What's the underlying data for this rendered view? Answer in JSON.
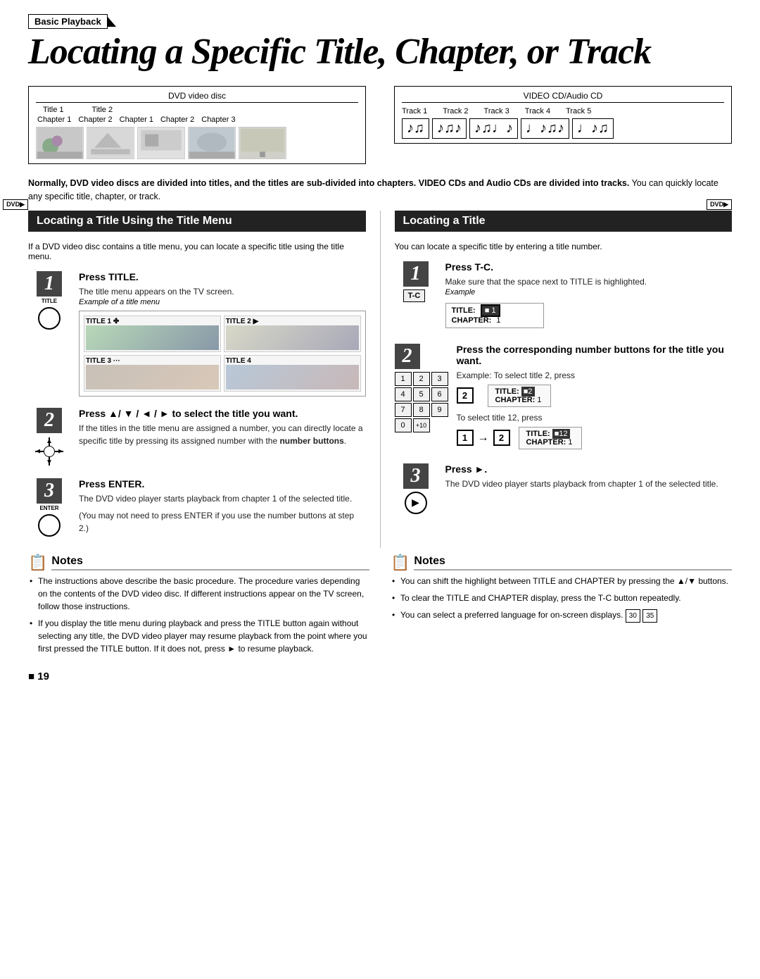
{
  "page": {
    "breadcrumb": "Basic Playback",
    "title": "Locating a Specific Title, Chapter, or Track",
    "page_number": "■ 19"
  },
  "dvd_diagram": {
    "label": "DVD video disc",
    "title1": "Title 1",
    "title2": "Title 2",
    "chapters": [
      "Chapter 1",
      "Chapter 2",
      "Chapter 1",
      "Chapter 2",
      "Chapter 3"
    ]
  },
  "cd_diagram": {
    "label": "VIDEO CD/Audio CD",
    "tracks": [
      "Track 1",
      "Track 2",
      "Track 3",
      "Track 4",
      "Track 5"
    ]
  },
  "intro_text": "Normally, DVD video discs are divided into titles, and the titles are sub-divided into chapters. VIDEO CDs and Audio CDs are divided into tracks. You can quickly locate any specific title, chapter, or track.",
  "left_section": {
    "header": "Locating a Title Using the Title Menu",
    "badge": "DVD",
    "intro": "If a DVD video disc contains a title menu, you can locate a specific title using the title menu.",
    "step1": {
      "number": "1",
      "icon_label": "TITLE",
      "title": "Press TITLE.",
      "desc1": "The title menu appears on the TV screen.",
      "example_label": "Example of a title menu",
      "titles": [
        "TITLE 1",
        "TITLE 2",
        "TITLE 3",
        "TITLE 4"
      ]
    },
    "step2": {
      "number": "2",
      "title": "Press ▲/ ▼ / ◄ / ► to select the title you want.",
      "desc1": "If the titles in the title menu are assigned a number, you can directly locate a specific title by pressing its assigned number with the",
      "desc_bold": "number buttons",
      "desc2": "."
    },
    "step3": {
      "number": "3",
      "icon_label": "ENTER",
      "title": "Press ENTER.",
      "desc1": "The DVD video player starts playback from chapter 1 of the selected title.",
      "desc2": "(You may not need to press ENTER if you use the number buttons at step 2.)"
    }
  },
  "right_section": {
    "header": "Locating a Title",
    "badge": "DVD",
    "intro": "You can locate a specific title by entering a title number.",
    "step1": {
      "number": "1",
      "icon_label": "T-C",
      "title": "Press T-C.",
      "desc1": "Make sure that the space next to TITLE is highlighted.",
      "example_label": "Example",
      "example_title": "TITLE:",
      "example_title_val": "■ 1",
      "example_chapter": "CHAPTER:",
      "example_chapter_val": "1"
    },
    "step2": {
      "number": "2",
      "title": "Press the corresponding number buttons for the title you want.",
      "desc1": "Example: To select title 2, press",
      "press_2": "2",
      "title_label1": "TITLE:",
      "title_val1": "■2",
      "chapter_label1": "CHAPTER:",
      "chapter_val1": "1",
      "desc2": "To select title 12, press",
      "press_1": "1",
      "press_2b": "2",
      "title_label2": "TITLE:",
      "title_val2": "■12",
      "chapter_label2": "CHAPTER:",
      "chapter_val2": "1",
      "num_buttons": [
        [
          "1",
          "2",
          "3"
        ],
        [
          "4",
          "5",
          "6"
        ],
        [
          "7",
          "8",
          "9"
        ],
        [
          "0",
          "+10"
        ]
      ]
    },
    "step3": {
      "number": "3",
      "title": "Press ►.",
      "desc1": "The DVD video player starts playback from chapter 1 of the selected title."
    }
  },
  "notes_left": {
    "title": "Notes",
    "items": [
      "The instructions above describe the basic procedure. The procedure varies depending on the contents of the DVD video disc. If different instructions appear on the TV screen, follow those instructions.",
      "If you display the title menu during playback and press the TITLE button again without selecting any title, the DVD video player may resume playback from the point where you first pressed the TITLE button. If it does not, press ► to resume playback."
    ]
  },
  "notes_right": {
    "title": "Notes",
    "items": [
      "You can shift the highlight between TITLE and CHAPTER by pressing the ▲/▼ buttons.",
      "To clear the TITLE and CHAPTER display, press the T-C button repeatedly.",
      "You can select a preferred language for on-screen displays. 30 35"
    ]
  }
}
